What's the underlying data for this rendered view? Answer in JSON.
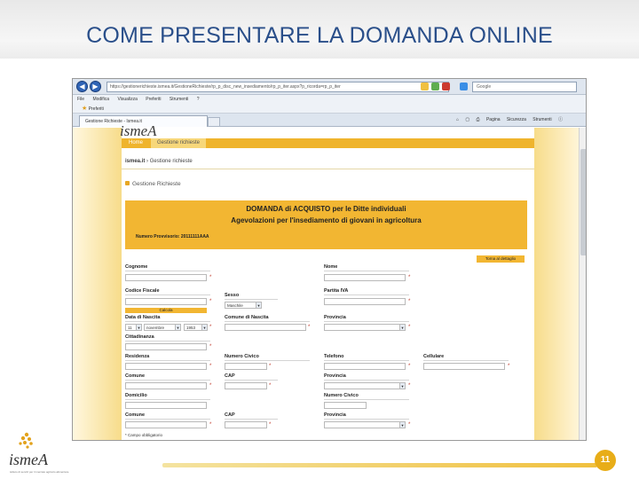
{
  "slide": {
    "title": "COME PRESENTARE LA DOMANDA ONLINE",
    "page_number": "11"
  },
  "browser": {
    "address": "https://gestionerichieste.ismea.it/GestioneRichieste/rp_p_disc_new_insediamento/rp_p_iter.aspx?p_ricorda=rp_p_iter",
    "search_placeholder": "Google",
    "menu": [
      "File",
      "Modifica",
      "Visualizza",
      "Preferiti",
      "Strumenti",
      "?"
    ],
    "favorites_label": "Preferiti",
    "tab_label": "Gestione Richieste - Ismea.it",
    "commands": [
      "Pagina",
      "Sicurezza",
      "Strumenti"
    ]
  },
  "site": {
    "logo_text": "ismeA",
    "nav": {
      "home": "Home",
      "gestione": "Gestione richieste"
    },
    "breadcrumb": {
      "home": "ismea.it",
      "current": "Gestione richieste"
    },
    "section_title": "Gestione Richieste",
    "banner": {
      "line1": "DOMANDA di ACQUISTO per le Ditte individuali",
      "line2": "Agevolazioni per l'insediamento di giovani in agricoltura",
      "numero": "Numero Provvisorio: 20111111AAA"
    },
    "detail_button": "Torna al dettaglio"
  },
  "form": {
    "cognome": "Cognome",
    "nome": "Nome",
    "codice_fiscale": "Codice Fiscale",
    "sesso": "Sesso",
    "sesso_value": "Maschile",
    "partita_iva": "Partita IVA",
    "calcola": "Calcola",
    "data_nascita": "Data di Nascita",
    "giorno": "11",
    "mese": "novembre",
    "anno": "1953",
    "comune_nascita": "Comune di Nascita",
    "provincia": "Provincia",
    "cittadinanza": "Cittadinanza",
    "residenza": "Residenza",
    "numero_civico": "Numero Civico",
    "telefono": "Telefono",
    "cellulare": "Cellulare",
    "comune": "Comune",
    "cap": "CAP",
    "domicilio": "Domicilio",
    "note": "* Campo obbligatorio"
  },
  "branding": {
    "logo_word": "ismeA",
    "tagline": "istituto di servizi per il mercato agricolo alimentare"
  },
  "colors": {
    "title_blue": "#2a4f8a",
    "accent_orange": "#f2b632",
    "badge": "#e8ad18"
  }
}
